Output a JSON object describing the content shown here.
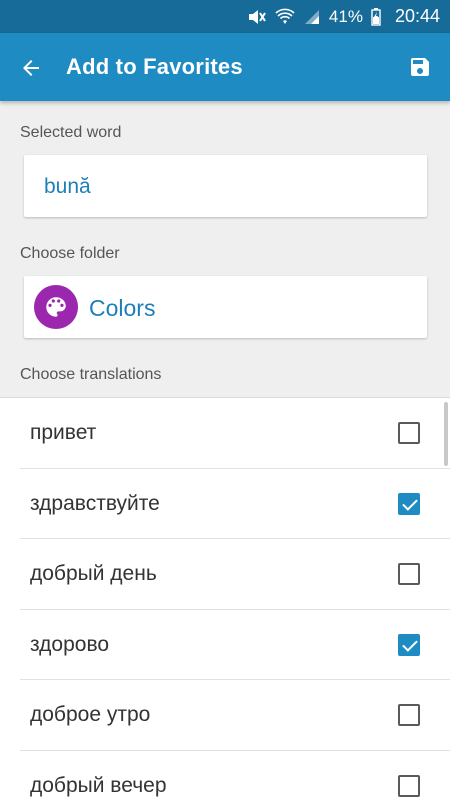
{
  "status_bar": {
    "battery": "41%",
    "time": "20:44"
  },
  "app_bar": {
    "title": "Add to Favorites",
    "color": "#1e8bc3"
  },
  "selected_word": {
    "label": "Selected word",
    "value": "bună"
  },
  "folder": {
    "label": "Choose folder",
    "name": "Colors",
    "icon": "palette-icon",
    "icon_color": "#9b27af"
  },
  "translations": {
    "label": "Choose translations",
    "items": [
      {
        "text": "привет",
        "checked": false
      },
      {
        "text": "здравствуйте",
        "checked": true
      },
      {
        "text": "добрый день",
        "checked": false
      },
      {
        "text": "здорово",
        "checked": true
      },
      {
        "text": "доброе утро",
        "checked": false
      },
      {
        "text": "добрый вечер",
        "checked": false
      }
    ]
  }
}
